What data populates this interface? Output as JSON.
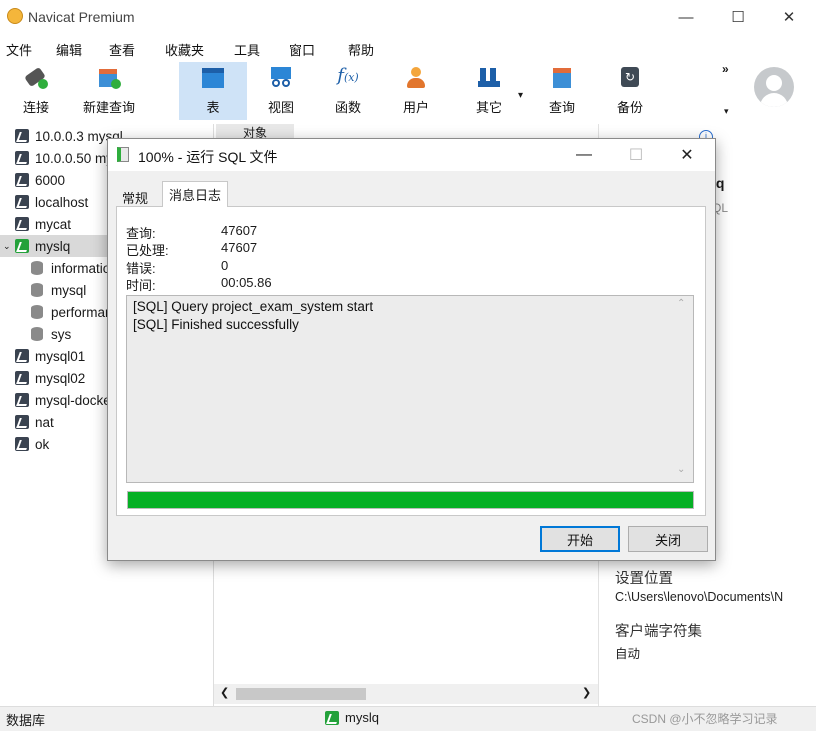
{
  "app": {
    "title": "Navicat Premium"
  },
  "window_controls": {
    "minimize": "—",
    "maximize": "☐",
    "close": "✕"
  },
  "menu": [
    "文件",
    "编辑",
    "查看",
    "收藏夹",
    "工具",
    "窗口",
    "帮助"
  ],
  "toolbar": {
    "items": [
      "连接",
      "新建查询",
      "表",
      "视图",
      "函数",
      "用户",
      "其它",
      "查询",
      "备份"
    ],
    "overflow": "»"
  },
  "sidebar": {
    "connections": [
      {
        "label": "10.0.0.3 mysql"
      },
      {
        "label": "10.0.0.50 mysql"
      },
      {
        "label": "6000"
      },
      {
        "label": "localhost"
      },
      {
        "label": "mycat"
      },
      {
        "label": "myslq",
        "selected": true,
        "children": [
          "information_schema",
          "mysql",
          "performance_schema",
          "sys"
        ]
      },
      {
        "label": "mysql01"
      },
      {
        "label": "mysql02"
      },
      {
        "label": "mysql-docker"
      },
      {
        "label": "nat"
      },
      {
        "label": "ok"
      }
    ]
  },
  "middle": {
    "objects_tab": "对象"
  },
  "right_pane": {
    "name_fragment": "lq",
    "type_fragment": "QL",
    "settings_location_label": "设置位置",
    "settings_location_value": "C:\\Users\\lenovo\\Documents\\N",
    "client_charset_label": "客户端字符集",
    "client_charset_value": "自动"
  },
  "statusbar": {
    "left": "数据库",
    "connection": "myslq",
    "watermark": "CSDN @小不忽略学习记录"
  },
  "dialog": {
    "title": "100% - 运行 SQL 文件",
    "tabs": [
      "常规",
      "消息日志"
    ],
    "active_tab": "消息日志",
    "stats": [
      {
        "label": "查询:",
        "value": "47607"
      },
      {
        "label": "已处理:",
        "value": "47607"
      },
      {
        "label": "错误:",
        "value": "0"
      },
      {
        "label": "时间:",
        "value": "00:05.86"
      }
    ],
    "log": [
      "[SQL] Query project_exam_system start",
      "[SQL] Finished successfully"
    ],
    "progress_percent": 100,
    "start_button": "开始",
    "close_button": "关闭"
  },
  "colors": {
    "progress": "#06b025",
    "selected_tool": "#cfe3f7",
    "accent": "#0078d7"
  }
}
